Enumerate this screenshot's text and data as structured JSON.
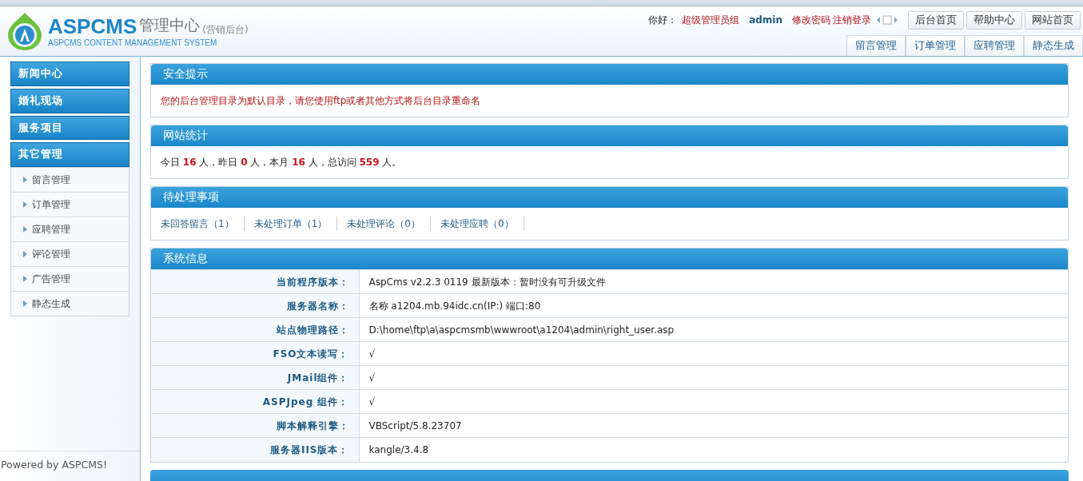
{
  "header": {
    "logo_title": "ASPCMS",
    "logo_sub": "管理中心",
    "logo_note": "(营销后台)",
    "logo_tagline": "ASPCMS CONTENT MANAGEMENT SYSTEM",
    "greeting": "你好：",
    "role": "超级管理员组",
    "user": "admin",
    "links": [
      "修改密码",
      "注销登录"
    ],
    "buttons": [
      "后台首页",
      "帮助中心",
      "网站首页"
    ],
    "tabs": [
      "留言管理",
      "订单管理",
      "应聘管理",
      "静态生成"
    ]
  },
  "sidebar": {
    "groups": [
      {
        "label": "新闻中心",
        "expanded": false
      },
      {
        "label": "婚礼现场",
        "expanded": false
      },
      {
        "label": "服务项目",
        "expanded": false
      },
      {
        "label": "其它管理",
        "expanded": true,
        "children": [
          "留言管理",
          "订单管理",
          "应聘管理",
          "评论管理",
          "广告管理",
          "静态生成"
        ]
      }
    ],
    "footer": "Powered by ASPCMS!"
  },
  "panels": [
    {
      "kind": "notice",
      "title": "安全提示",
      "text": "您的后台管理目录为默认目录，请您使用ftp或者其他方式将后台目录重命名"
    },
    {
      "kind": "stats",
      "title": "网站统计",
      "text": "今日 **16** 人，昨日 **0** 人，本月 **16** 人，总访问 **559** 人。"
    },
    {
      "kind": "links",
      "title": "待处理事项",
      "links": [
        "未回答留言（1）",
        "未处理订单（1）",
        "未处理评论（0）",
        "未处理应聘（0）"
      ]
    },
    {
      "kind": "table",
      "title": "系统信息",
      "rows": [
        {
          "label": "当前程序版本：",
          "value": "AspCms v2.2.3 0119 最新版本：暂时没有可升级文件"
        },
        {
          "label": "服务器名称：",
          "value": "名称 a1204.mb.94idc.cn(IP:) 端口:80"
        },
        {
          "label": "站点物理路径：",
          "value": "D:\\home\\ftp\\a\\aspcmsmb\\wwwroot\\a1204\\admin\\right_user.asp"
        },
        {
          "label": "FSO文本读写：",
          "value": "√"
        },
        {
          "label": "JMail组件：",
          "value": "√"
        },
        {
          "label": "ASPJpeg 组件：",
          "value": "√"
        },
        {
          "label": "脚本解释引擎：",
          "value": "VBScript/5.8.23707"
        },
        {
          "label": "服务器IIS版本：",
          "value": "kangle/3.4.8"
        }
      ]
    },
    {
      "kind": "cut"
    }
  ]
}
